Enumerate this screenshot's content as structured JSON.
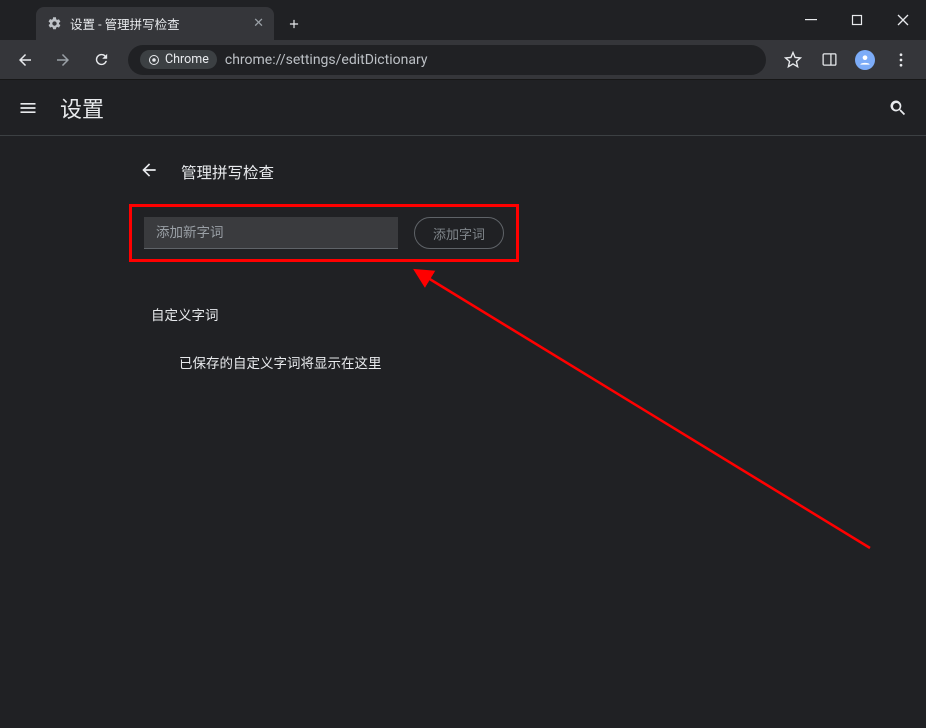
{
  "browser": {
    "tab_title": "设置 - 管理拼写检查",
    "url_chip_label": "Chrome",
    "url": "chrome://settings/editDictionary"
  },
  "header": {
    "title": "设置"
  },
  "subpage": {
    "title": "管理拼写检查"
  },
  "add_word": {
    "input_placeholder": "添加新字词",
    "button_label": "添加字词"
  },
  "custom_words": {
    "section_title": "自定义字词",
    "empty_message": "已保存的自定义字词将显示在这里"
  }
}
